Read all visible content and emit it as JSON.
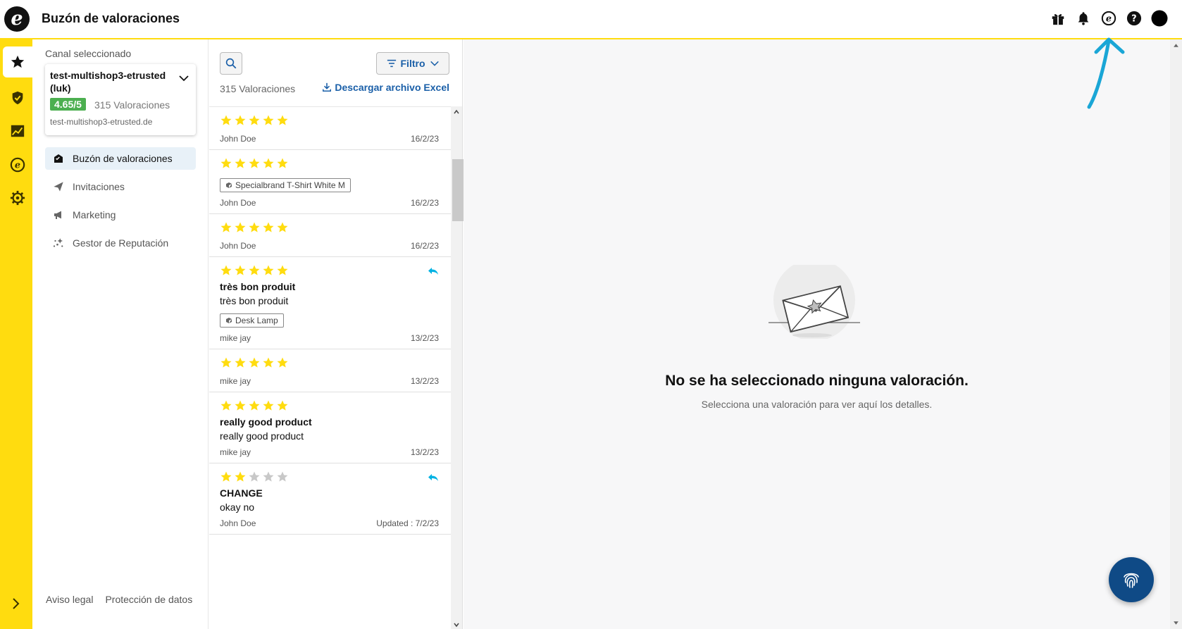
{
  "app": {
    "title": "Buzón de valoraciones"
  },
  "colors": {
    "brand_yellow": "#ffdc0f",
    "link_blue": "#1a5fa8",
    "star_gold": "#ffdc0f",
    "badge_green": "#4caf50",
    "reply_cyan": "#00b2e3",
    "fab_blue": "#0f4a86"
  },
  "topbar_icons": [
    "gift-icon",
    "bell-icon",
    "etrusted-icon",
    "help-icon",
    "avatar"
  ],
  "rail": {
    "items": [
      "star-icon",
      "shield-check-icon",
      "chart-icon",
      "etrusted-icon",
      "gear-icon"
    ],
    "active_index": 0
  },
  "sidebar": {
    "channel_label": "Canal seleccionado",
    "channel": {
      "name": "test-multishop3-etrusted (luk)",
      "score": "4.65/5",
      "count": "315 Valoraciones",
      "url": "test-multishop3-etrusted.de"
    },
    "nav": [
      {
        "label": "Buzón de valoraciones",
        "icon": "inbox-icon",
        "active": true
      },
      {
        "label": "Invitaciones",
        "icon": "paper-plane-icon",
        "active": false
      },
      {
        "label": "Marketing",
        "icon": "megaphone-icon",
        "active": false
      },
      {
        "label": "Gestor de Reputación",
        "icon": "sparkle-icon",
        "active": false
      }
    ],
    "footer": {
      "legal": "Aviso legal",
      "privacy": "Protección de datos"
    }
  },
  "list": {
    "filter_label": "Filtro",
    "count_label": "315 Valoraciones",
    "download_label": "Descargar archivo Excel",
    "reviews": [
      {
        "stars": 5,
        "title": "",
        "body": "",
        "product": "",
        "author": "John Doe",
        "date": "16/2/23",
        "replied": false
      },
      {
        "stars": 5,
        "title": "",
        "body": "",
        "product": "Specialbrand T-Shirt White M",
        "author": "John Doe",
        "date": "16/2/23",
        "replied": false
      },
      {
        "stars": 5,
        "title": "",
        "body": "",
        "product": "",
        "author": "John Doe",
        "date": "16/2/23",
        "replied": false
      },
      {
        "stars": 5,
        "title": "très bon produit",
        "body": "très bon produit",
        "product": "Desk Lamp",
        "author": "mike jay",
        "date": "13/2/23",
        "replied": true
      },
      {
        "stars": 5,
        "title": "",
        "body": "",
        "product": "",
        "author": "mike jay",
        "date": "13/2/23",
        "replied": false
      },
      {
        "stars": 5,
        "title": "really good product",
        "body": "really good product",
        "product": "",
        "author": "mike jay",
        "date": "13/2/23",
        "replied": false
      },
      {
        "stars": 2,
        "title": "CHANGE",
        "body": "okay no",
        "product": "",
        "author": "John Doe",
        "date": "Updated : 7/2/23",
        "replied": true
      }
    ]
  },
  "detail": {
    "empty_title": "No se ha seleccionado ninguna valoración.",
    "empty_subtitle": "Selecciona una valoración para ver aquí los detalles."
  }
}
